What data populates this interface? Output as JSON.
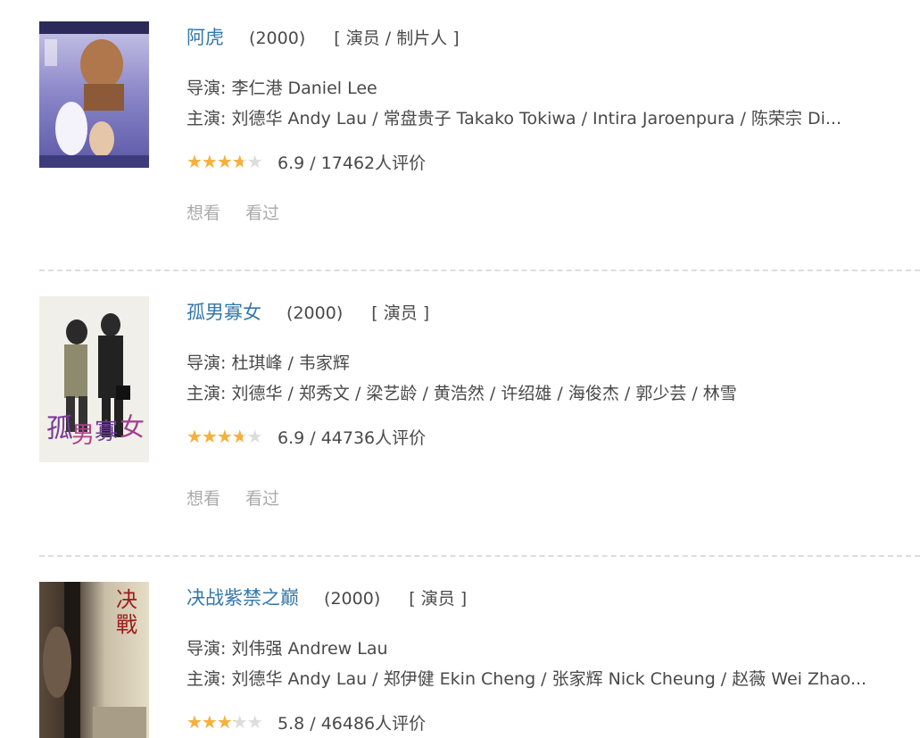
{
  "colors": {
    "link": "#3377aa",
    "text": "#494949",
    "muted": "#aaaaaa",
    "star": "#f7b03a",
    "star_empty": "#dcdcdc",
    "divider": "#dddddd"
  },
  "movies": [
    {
      "title": "阿虎",
      "year": "(2000)",
      "role": "[ 演员 / 制片人 ]",
      "director": "导演: 李仁港 Daniel Lee",
      "cast": "主演: 刘德华 Andy Lau / 常盘贵子 Takako Tokiwa / Intira Jaroenpura / 陈荣宗 Di...",
      "rating_text": "6.9 / 17462人评价",
      "stars": 3.5,
      "want": "想看",
      "seen": "看过",
      "poster_icon": "poster-fighters-blues"
    },
    {
      "title": "孤男寡女",
      "year": "(2000)",
      "role": "[ 演员 ]",
      "director": "导演: 杜琪峰 / 韦家辉",
      "cast": "主演: 刘德华 / 郑秀文 / 梁艺龄 / 黄浩然 / 许绍雄 / 海俊杰 / 郭少芸 / 林雪",
      "rating_text": "6.9 / 44736人评价",
      "stars": 3.5,
      "want": "想看",
      "seen": "看过",
      "poster_icon": "poster-needing-you"
    },
    {
      "title": "决战紫禁之巅",
      "year": "(2000)",
      "role": "[ 演员 ]",
      "director": "导演: 刘伟强 Andrew Lau",
      "cast": "主演: 刘德华 Andy Lau / 郑伊健 Ekin Cheng / 张家辉 Nick Cheung / 赵薇 Wei Zhao...",
      "rating_text": "5.8 / 46486人评价",
      "stars": 3,
      "poster_icon": "poster-duel"
    }
  ]
}
